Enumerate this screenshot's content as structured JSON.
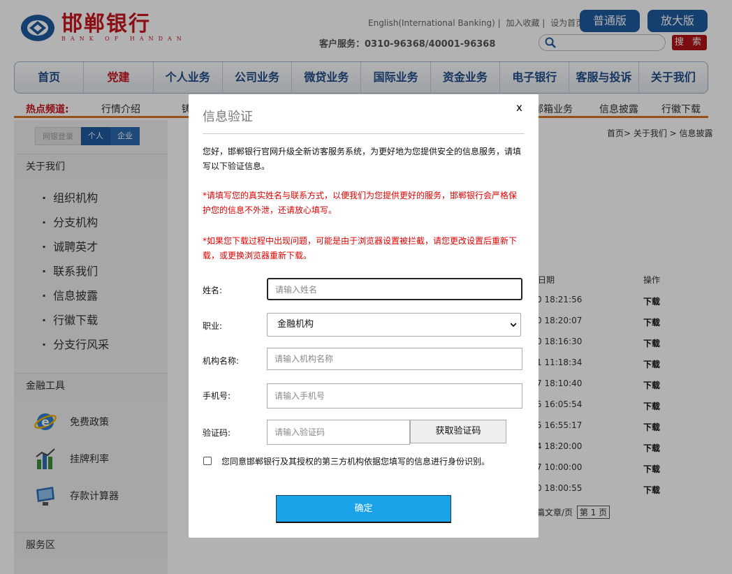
{
  "header": {
    "logo_cn": "邯郸银行",
    "logo_en": "BANK OF HANDAN",
    "top_links": [
      "English(International Banking) |",
      "加入收藏 |",
      "设为首页"
    ],
    "hotline": "客户服务：0310-96368/40001-96368",
    "version_normal": "普通版",
    "version_large": "放大版",
    "search_placeholder": "",
    "search_button": "搜 索"
  },
  "nav": {
    "items": [
      "首页",
      "党建",
      "个人业务",
      "公司业务",
      "微贷业务",
      "国际业务",
      "资金业务",
      "电子银行",
      "客服与投诉",
      "关于我们"
    ]
  },
  "hot": {
    "label": "热点频道:",
    "links": [
      "行情介绍",
      "铸",
      "邮箱业务",
      "信息披露",
      "行徽下载"
    ]
  },
  "sidebar": {
    "login": [
      "网银登录",
      "个人",
      "企业"
    ],
    "about_title": "关于我们",
    "about_items": [
      "组织机构",
      "分支机构",
      "诚聘英才",
      "联系我们",
      "信息披露",
      "行徽下载",
      "分支行风采"
    ],
    "tools_title": "金融工具",
    "tools": [
      "免费政策",
      "挂牌利率",
      "存款计算器"
    ],
    "service_title": "服务区"
  },
  "main": {
    "breadcrumb": "首页> 关于我们 > 信息披露",
    "col_date": "日期",
    "col_action": "操作",
    "rows": [
      {
        "time": "0 18:21:56",
        "action": "下载"
      },
      {
        "time": "0 18:20:07",
        "action": "下载"
      },
      {
        "time": "0 18:16:30",
        "action": "下载"
      },
      {
        "time": "1 11:18:34",
        "action": "下载"
      },
      {
        "time": "7 18:10:40",
        "action": "下载"
      },
      {
        "time": "5 16:05:54",
        "action": "下载"
      },
      {
        "time": "5 16:55:17",
        "action": "下载"
      },
      {
        "time": "4 18:20:00",
        "action": "下载"
      },
      {
        "time": "7 10:00:00",
        "action": "下载"
      },
      {
        "time": "0 18:00:55",
        "action": "下载"
      }
    ],
    "pager_text": "篇文章/页",
    "pager_select": "第 1 页"
  },
  "modal": {
    "title": "信息验证",
    "close": "x",
    "intro": "您好，邯郸银行官网升级全新访客服务系统，为更好地为您提供安全的信息服务，请填写以下验证信息。",
    "notice1": "*请填写您的真实姓名与联系方式，以便我们为您提供更好的服务，邯郸银行会严格保护您的信息不外泄，还请放心填写。",
    "notice2": "*如果您下载过程中出现问题，可能是由于浏览器设置被拦截，请您更改设置后重新下载，或更换浏览器重新下载。",
    "name_label": "姓名:",
    "name_placeholder": "请输入姓名",
    "job_label": "职业:",
    "job_value": "金融机构",
    "org_label": "机构名称:",
    "org_placeholder": "请输入机构名称",
    "phone_label": "手机号:",
    "phone_placeholder": "请输入手机号",
    "code_label": "验证码:",
    "code_placeholder": "请输入验证码",
    "code_button": "获取验证码",
    "agree_text": "您同意邯郸银行及其授权的第三方机构依据您填写的信息进行身份识别。",
    "submit": "确定"
  },
  "colors": {
    "brand_red": "#c8161d",
    "brand_blue": "#1f5ba0",
    "submit_blue": "#1aa3e8",
    "notice_red": "#e00000"
  }
}
